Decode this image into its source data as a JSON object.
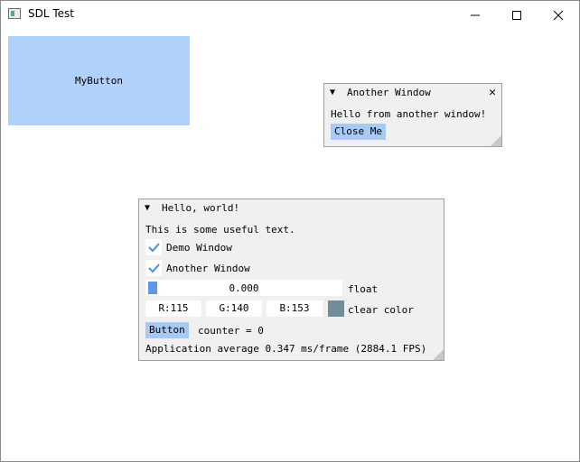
{
  "app": {
    "title": "SDL Test"
  },
  "canvas": {
    "button_label": "MyButton"
  },
  "another_window": {
    "title": "Another Window",
    "text": "Hello from another window!",
    "close_button": "Close Me"
  },
  "hello_window": {
    "title": "Hello, world!",
    "text": "This is some useful text.",
    "checkbox_demo": {
      "label": "Demo Window",
      "checked": true
    },
    "checkbox_another": {
      "label": "Another Window",
      "checked": true
    },
    "slider": {
      "value": "0.000",
      "label": "float"
    },
    "color": {
      "r": "R:115",
      "g": "G:140",
      "b": "B:153",
      "label": "clear color",
      "swatch": "#738c99"
    },
    "button_label": "Button",
    "counter_text": "counter = 0",
    "fps_text": "Application average 0.347 ms/frame (2884.1 FPS)"
  }
}
